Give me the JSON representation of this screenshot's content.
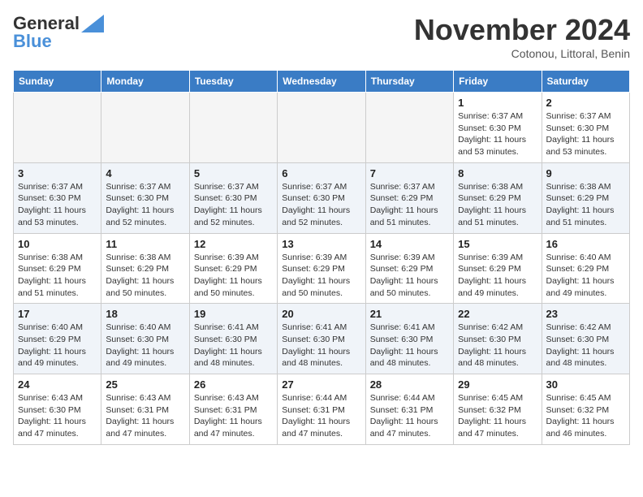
{
  "header": {
    "logo_line1": "General",
    "logo_line2": "Blue",
    "month_title": "November 2024",
    "location": "Cotonou, Littoral, Benin"
  },
  "weekdays": [
    "Sunday",
    "Monday",
    "Tuesday",
    "Wednesday",
    "Thursday",
    "Friday",
    "Saturday"
  ],
  "weeks": [
    [
      {
        "day": "",
        "info": ""
      },
      {
        "day": "",
        "info": ""
      },
      {
        "day": "",
        "info": ""
      },
      {
        "day": "",
        "info": ""
      },
      {
        "day": "",
        "info": ""
      },
      {
        "day": "1",
        "info": "Sunrise: 6:37 AM\nSunset: 6:30 PM\nDaylight: 11 hours and 53 minutes."
      },
      {
        "day": "2",
        "info": "Sunrise: 6:37 AM\nSunset: 6:30 PM\nDaylight: 11 hours and 53 minutes."
      }
    ],
    [
      {
        "day": "3",
        "info": "Sunrise: 6:37 AM\nSunset: 6:30 PM\nDaylight: 11 hours and 53 minutes."
      },
      {
        "day": "4",
        "info": "Sunrise: 6:37 AM\nSunset: 6:30 PM\nDaylight: 11 hours and 52 minutes."
      },
      {
        "day": "5",
        "info": "Sunrise: 6:37 AM\nSunset: 6:30 PM\nDaylight: 11 hours and 52 minutes."
      },
      {
        "day": "6",
        "info": "Sunrise: 6:37 AM\nSunset: 6:30 PM\nDaylight: 11 hours and 52 minutes."
      },
      {
        "day": "7",
        "info": "Sunrise: 6:37 AM\nSunset: 6:29 PM\nDaylight: 11 hours and 51 minutes."
      },
      {
        "day": "8",
        "info": "Sunrise: 6:38 AM\nSunset: 6:29 PM\nDaylight: 11 hours and 51 minutes."
      },
      {
        "day": "9",
        "info": "Sunrise: 6:38 AM\nSunset: 6:29 PM\nDaylight: 11 hours and 51 minutes."
      }
    ],
    [
      {
        "day": "10",
        "info": "Sunrise: 6:38 AM\nSunset: 6:29 PM\nDaylight: 11 hours and 51 minutes."
      },
      {
        "day": "11",
        "info": "Sunrise: 6:38 AM\nSunset: 6:29 PM\nDaylight: 11 hours and 50 minutes."
      },
      {
        "day": "12",
        "info": "Sunrise: 6:39 AM\nSunset: 6:29 PM\nDaylight: 11 hours and 50 minutes."
      },
      {
        "day": "13",
        "info": "Sunrise: 6:39 AM\nSunset: 6:29 PM\nDaylight: 11 hours and 50 minutes."
      },
      {
        "day": "14",
        "info": "Sunrise: 6:39 AM\nSunset: 6:29 PM\nDaylight: 11 hours and 50 minutes."
      },
      {
        "day": "15",
        "info": "Sunrise: 6:39 AM\nSunset: 6:29 PM\nDaylight: 11 hours and 49 minutes."
      },
      {
        "day": "16",
        "info": "Sunrise: 6:40 AM\nSunset: 6:29 PM\nDaylight: 11 hours and 49 minutes."
      }
    ],
    [
      {
        "day": "17",
        "info": "Sunrise: 6:40 AM\nSunset: 6:29 PM\nDaylight: 11 hours and 49 minutes."
      },
      {
        "day": "18",
        "info": "Sunrise: 6:40 AM\nSunset: 6:30 PM\nDaylight: 11 hours and 49 minutes."
      },
      {
        "day": "19",
        "info": "Sunrise: 6:41 AM\nSunset: 6:30 PM\nDaylight: 11 hours and 48 minutes."
      },
      {
        "day": "20",
        "info": "Sunrise: 6:41 AM\nSunset: 6:30 PM\nDaylight: 11 hours and 48 minutes."
      },
      {
        "day": "21",
        "info": "Sunrise: 6:41 AM\nSunset: 6:30 PM\nDaylight: 11 hours and 48 minutes."
      },
      {
        "day": "22",
        "info": "Sunrise: 6:42 AM\nSunset: 6:30 PM\nDaylight: 11 hours and 48 minutes."
      },
      {
        "day": "23",
        "info": "Sunrise: 6:42 AM\nSunset: 6:30 PM\nDaylight: 11 hours and 48 minutes."
      }
    ],
    [
      {
        "day": "24",
        "info": "Sunrise: 6:43 AM\nSunset: 6:30 PM\nDaylight: 11 hours and 47 minutes."
      },
      {
        "day": "25",
        "info": "Sunrise: 6:43 AM\nSunset: 6:31 PM\nDaylight: 11 hours and 47 minutes."
      },
      {
        "day": "26",
        "info": "Sunrise: 6:43 AM\nSunset: 6:31 PM\nDaylight: 11 hours and 47 minutes."
      },
      {
        "day": "27",
        "info": "Sunrise: 6:44 AM\nSunset: 6:31 PM\nDaylight: 11 hours and 47 minutes."
      },
      {
        "day": "28",
        "info": "Sunrise: 6:44 AM\nSunset: 6:31 PM\nDaylight: 11 hours and 47 minutes."
      },
      {
        "day": "29",
        "info": "Sunrise: 6:45 AM\nSunset: 6:32 PM\nDaylight: 11 hours and 47 minutes."
      },
      {
        "day": "30",
        "info": "Sunrise: 6:45 AM\nSunset: 6:32 PM\nDaylight: 11 hours and 46 minutes."
      }
    ]
  ]
}
